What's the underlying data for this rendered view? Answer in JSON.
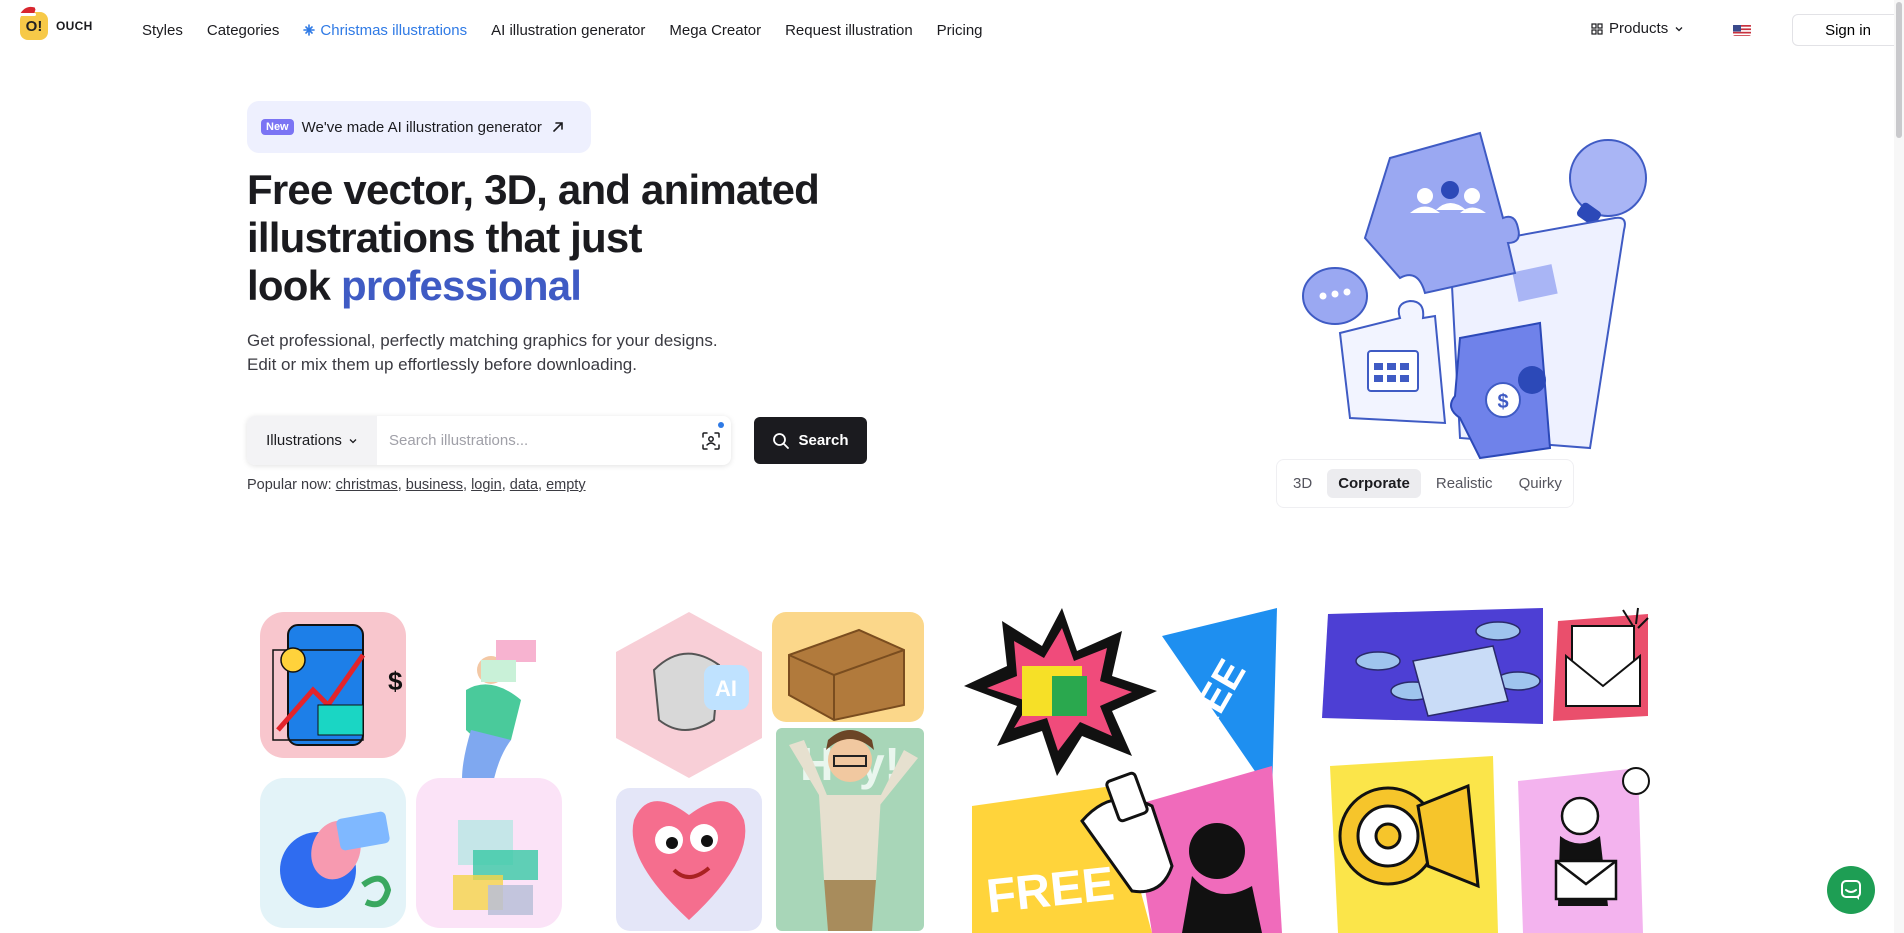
{
  "header": {
    "logo_text": "OUCH",
    "logo_mark": "O!",
    "nav": [
      {
        "label": "Styles"
      },
      {
        "label": "Categories"
      },
      {
        "label": "Christmas illustrations",
        "icon": "snowflake-icon",
        "active": true
      },
      {
        "label": "AI illustration generator"
      },
      {
        "label": "Mega Creator"
      },
      {
        "label": "Request illustration"
      },
      {
        "label": "Pricing"
      }
    ],
    "products_label": "Products",
    "language_flag": "us-flag-icon",
    "signin_label": "Sign in"
  },
  "hero": {
    "badge_new": "New",
    "badge_text": "We've made AI illustration generator",
    "title_line1": "Free vector, 3D, and animated",
    "title_line2": "illustrations that just",
    "title_line3_prefix": "look ",
    "title_accent": "professional",
    "subtitle_line1": "Get professional, perfectly matching graphics for your designs.",
    "subtitle_line2": "Edit or mix them up effortlessly before downloading."
  },
  "search": {
    "type_label": "Illustrations",
    "placeholder": "Search illustrations...",
    "value": "",
    "button_label": "Search",
    "popular_prefix": "Popular now:",
    "popular": [
      "christmas",
      "business",
      "login",
      "data",
      "empty"
    ]
  },
  "style_tabs": [
    {
      "label": "3D",
      "active": false
    },
    {
      "label": "Corporate",
      "active": true
    },
    {
      "label": "Realistic",
      "active": false
    },
    {
      "label": "Quirky",
      "active": false
    }
  ],
  "gallery": {
    "tile2_text": "AI",
    "tile2_sign": "Hey!",
    "tile3_word1": "FREE",
    "tile3_word2": "FREE"
  },
  "colors": {
    "accent_blue": "#3f5bc4",
    "active_nav": "#2f7ae5",
    "badge_bg": "#eef0fe",
    "badge_new": "#7b74f4",
    "chat": "#1e9e54"
  }
}
